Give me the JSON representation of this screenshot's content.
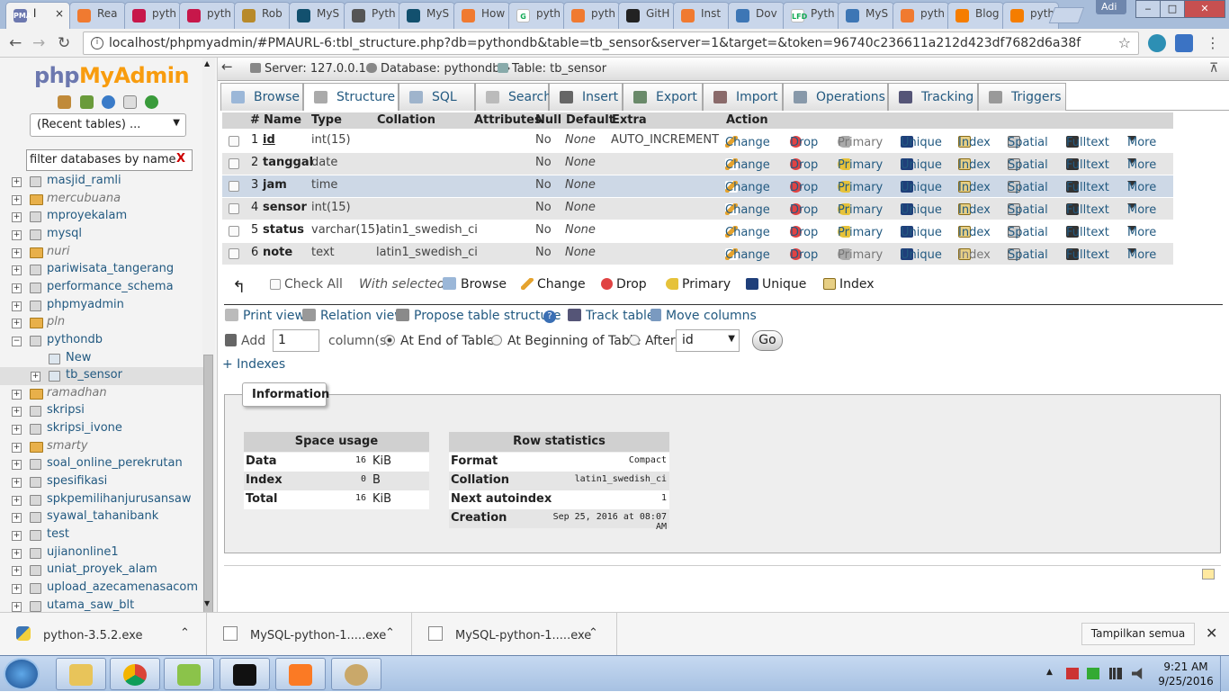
{
  "browser": {
    "tabs": [
      {
        "label": "l",
        "icon": "pma-icon",
        "active": true
      },
      {
        "label": "Rea",
        "icon": "sketch-icon"
      },
      {
        "label": "pyth",
        "icon": "raspberry-icon"
      },
      {
        "label": "pyth",
        "icon": "raspberry-icon"
      },
      {
        "label": "Rob",
        "icon": "robot-icon"
      },
      {
        "label": "MyS",
        "icon": "mysql-icon"
      },
      {
        "label": "Pyth",
        "icon": "diamond-icon"
      },
      {
        "label": "MyS",
        "icon": "mysql-icon"
      },
      {
        "label": "How",
        "icon": "sketch-icon"
      },
      {
        "label": "pyth",
        "icon": "google-icon"
      },
      {
        "label": "pyth",
        "icon": "sketch-icon"
      },
      {
        "label": "GitH",
        "icon": "github-icon"
      },
      {
        "label": "Inst",
        "icon": "sketch-icon"
      },
      {
        "label": "Dov",
        "icon": "python-icon"
      },
      {
        "label": "Pyth",
        "icon": "lfd-icon"
      },
      {
        "label": "MyS",
        "icon": "python-icon"
      },
      {
        "label": "pyth",
        "icon": "sketch-icon"
      },
      {
        "label": "Blog",
        "icon": "blogger-icon"
      },
      {
        "label": "pyth",
        "icon": "blogger-icon"
      }
    ],
    "tab_icon_labels": {
      "pma": "PMA",
      "lfd": "LFD",
      "google": "G"
    },
    "user": "Adi",
    "url": "localhost/phpmyadmin/#PMAURL-6:tbl_structure.php?db=pythondb&table=tb_sensor&server=1&target=&token=96740c236611a212d423df7682d6a38f",
    "window_buttons": {
      "minimize": "‒",
      "maximize": "□",
      "close": "✕"
    }
  },
  "sidebar": {
    "logo_php": "php",
    "logo_myadmin": "MyAdmin",
    "recent_tables": "(Recent tables) ...",
    "filter_placeholder": "filter databases by name",
    "filter_clear": "X",
    "databases": [
      {
        "name": "masjid_ramli",
        "group": false
      },
      {
        "name": "mercubuana",
        "group": true
      },
      {
        "name": "mproyekalam",
        "group": false
      },
      {
        "name": "mysql",
        "group": false
      },
      {
        "name": "nuri",
        "group": true
      },
      {
        "name": "pariwisata_tangerang",
        "group": false
      },
      {
        "name": "performance_schema",
        "group": false
      },
      {
        "name": "phpmyadmin",
        "group": false
      },
      {
        "name": "pln",
        "group": true
      },
      {
        "name": "pythondb",
        "group": false,
        "expanded": true
      },
      {
        "name": "New",
        "group": false,
        "child": true
      },
      {
        "name": "tb_sensor",
        "group": false,
        "child": true,
        "selected": true
      },
      {
        "name": "ramadhan",
        "group": true
      },
      {
        "name": "skripsi",
        "group": false
      },
      {
        "name": "skripsi_ivone",
        "group": false
      },
      {
        "name": "smarty",
        "group": true
      },
      {
        "name": "soal_online_perekrutan",
        "group": false
      },
      {
        "name": "spesifikasi",
        "group": false
      },
      {
        "name": "spkpemilihanjurusansaw",
        "group": false
      },
      {
        "name": "syawal_tahanibank",
        "group": false
      },
      {
        "name": "test",
        "group": false
      },
      {
        "name": "ujianonline1",
        "group": false
      },
      {
        "name": "uniat_proyek_alam",
        "group": false
      },
      {
        "name": "upload_azecamenasacom",
        "group": false
      },
      {
        "name": "utama_saw_blt",
        "group": false
      }
    ]
  },
  "breadcrumb": {
    "server": "Server: 127.0.0.1 »",
    "database": "Database: pythondb »",
    "table": "Table: tb_sensor"
  },
  "tabs": [
    "Browse",
    "Structure",
    "SQL",
    "Search",
    "Insert",
    "Export",
    "Import",
    "Operations",
    "Tracking",
    "Triggers"
  ],
  "structure": {
    "headers": {
      "num": "#",
      "name": "Name",
      "type": "Type",
      "collation": "Collation",
      "attributes": "Attributes",
      "null": "Null",
      "default": "Default",
      "extra": "Extra",
      "action": "Action"
    },
    "actions": {
      "change": "Change",
      "drop": "Drop",
      "primary": "Primary",
      "unique": "Unique",
      "index": "Index",
      "spatial": "Spatial",
      "fulltext": "Fulltext",
      "more": "More"
    },
    "rows": [
      {
        "num": "1",
        "name": "id",
        "type": "int(15)",
        "collation": "",
        "null": "No",
        "default": "None",
        "extra": "AUTO_INCREMENT",
        "primary_key": true
      },
      {
        "num": "2",
        "name": "tanggal",
        "type": "date",
        "collation": "",
        "null": "No",
        "default": "None",
        "extra": ""
      },
      {
        "num": "3",
        "name": "jam",
        "type": "time",
        "collation": "",
        "null": "No",
        "default": "None",
        "extra": ""
      },
      {
        "num": "4",
        "name": "sensor",
        "type": "int(15)",
        "collation": "",
        "null": "No",
        "default": "None",
        "extra": ""
      },
      {
        "num": "5",
        "name": "status",
        "type": "varchar(15)",
        "collation": "latin1_swedish_ci",
        "null": "No",
        "default": "None",
        "extra": ""
      },
      {
        "num": "6",
        "name": "note",
        "type": "text",
        "collation": "latin1_swedish_ci",
        "null": "No",
        "default": "None",
        "extra": ""
      }
    ]
  },
  "bulk": {
    "check_all": "Check All",
    "with_selected": "With selected:",
    "browse": "Browse",
    "change": "Change",
    "drop": "Drop",
    "primary": "Primary",
    "unique": "Unique",
    "index": "Index"
  },
  "links": {
    "print_view": "Print view",
    "relation_view": "Relation view",
    "propose": "Propose table structure",
    "track_table": "Track table",
    "move_columns": "Move columns"
  },
  "add_columns": {
    "add": "Add",
    "count": "1",
    "columns": "column(s)",
    "at_end": "At End of Table",
    "at_beginning": "At Beginning of Table",
    "after": "After",
    "after_value": "id",
    "go": "Go"
  },
  "indexes_link": "+ Indexes",
  "information": {
    "legend": "Information",
    "space_usage": {
      "title": "Space usage",
      "rows": [
        {
          "label": "Data",
          "value": "16",
          "unit": "KiB"
        },
        {
          "label": "Index",
          "value": "0",
          "unit": "B"
        },
        {
          "label": "Total",
          "value": "16",
          "unit": "KiB"
        }
      ]
    },
    "row_statistics": {
      "title": "Row statistics",
      "rows": [
        {
          "label": "Format",
          "value": "Compact"
        },
        {
          "label": "Collation",
          "value": "latin1_swedish_ci"
        },
        {
          "label": "Next autoindex",
          "value": "1"
        },
        {
          "label": "Creation",
          "value": "Sep 25, 2016 at 08:07 AM"
        }
      ]
    }
  },
  "downloads": {
    "items": [
      "python-3.5.2.exe",
      "MySQL-python-1.....exe",
      "MySQL-python-1.....exe"
    ],
    "show_all": "Tampilkan semua",
    "close": "✕"
  },
  "taskbar": {
    "time": "9:21 AM",
    "date": "9/25/2016"
  },
  "colors": {
    "link": "#235a81",
    "accent_orange": "#f89c0e",
    "logo_blue": "#6c78af"
  }
}
